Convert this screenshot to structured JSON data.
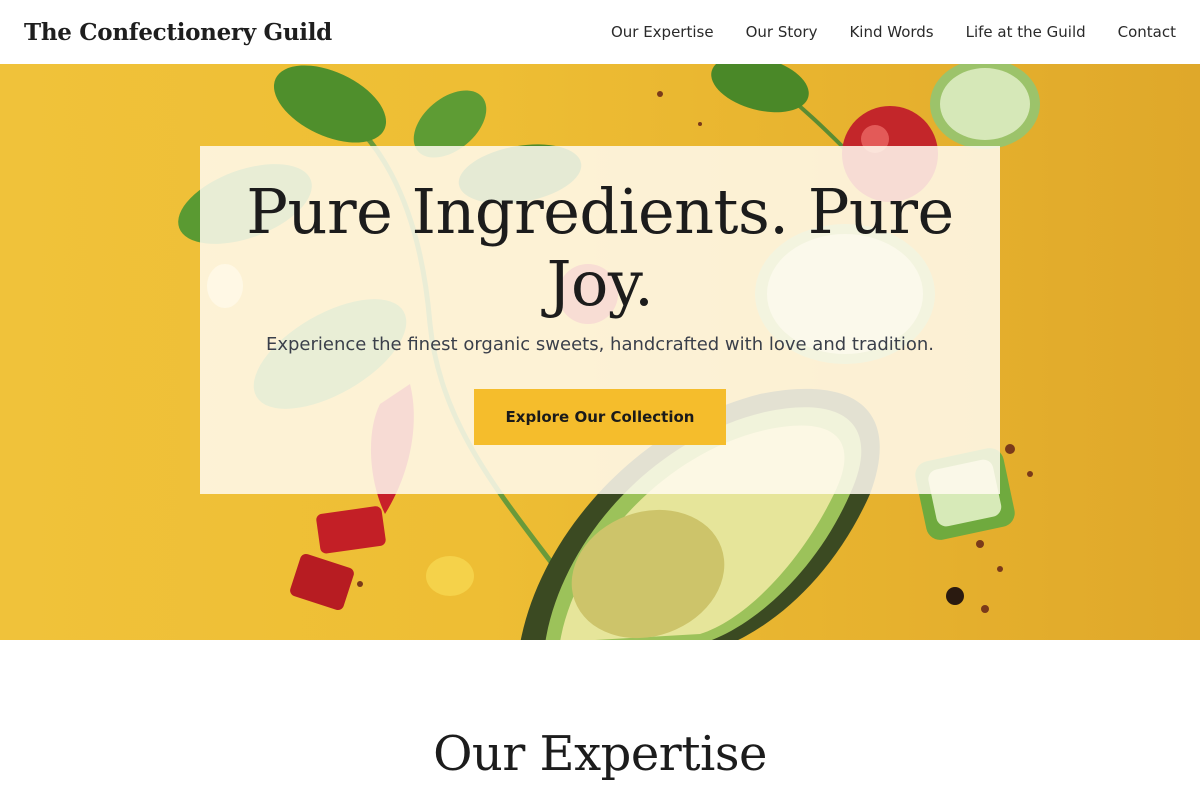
{
  "brand": {
    "name": "The Confectionery Guild"
  },
  "nav": {
    "items": [
      {
        "label": "Our Expertise"
      },
      {
        "label": "Our Story"
      },
      {
        "label": "Kind Words"
      },
      {
        "label": "Life at the Guild"
      },
      {
        "label": "Contact"
      }
    ]
  },
  "hero": {
    "title": "Pure Ingredients. Pure Joy.",
    "subtitle": "Experience the finest organic sweets, handcrafted with love and tradition.",
    "cta_label": "Explore Our Collection",
    "background": "food-ingredients-photo"
  },
  "expertise": {
    "title": "Our Expertise"
  },
  "colors": {
    "accent": "#f5bd2c",
    "hero_bg": "#eebe34",
    "text_dark": "#1c1c1c"
  }
}
